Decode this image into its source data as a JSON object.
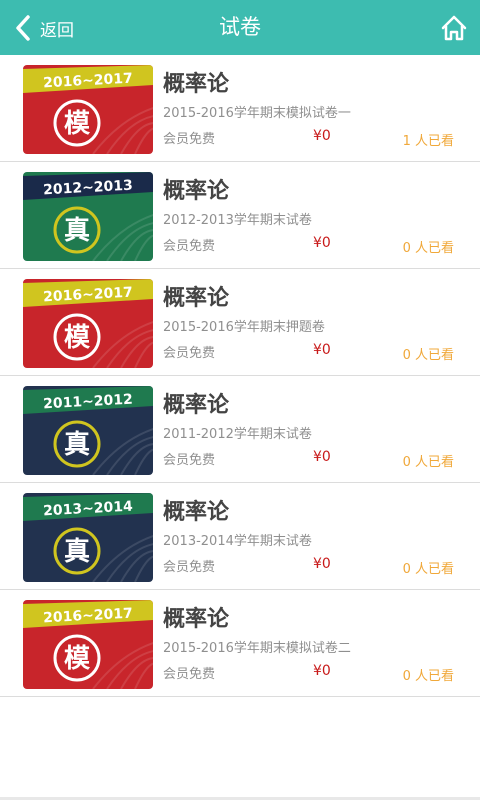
{
  "header": {
    "back_label": "返回",
    "title": "试卷",
    "bg_color": "#3dbcb0"
  },
  "items": [
    {
      "badge_year": "2016~2017",
      "badge_char": "模",
      "theme": "red",
      "name": "概率论",
      "subtitle": "2015-2016学年期末模拟试卷一",
      "member": "会员免费",
      "price": "¥0",
      "views": "1 人已看"
    },
    {
      "badge_year": "2012~2013",
      "badge_char": "真",
      "theme": "green",
      "name": "概率论",
      "subtitle": "2012-2013学年期末试卷",
      "member": "会员免费",
      "price": "¥0",
      "views": "0 人已看"
    },
    {
      "badge_year": "2016~2017",
      "badge_char": "模",
      "theme": "red",
      "name": "概率论",
      "subtitle": "2015-2016学年期末押题卷",
      "member": "会员免费",
      "price": "¥0",
      "views": "0 人已看"
    },
    {
      "badge_year": "2011~2012",
      "badge_char": "真",
      "theme": "navy",
      "name": "概率论",
      "subtitle": "2011-2012学年期末试卷",
      "member": "会员免费",
      "price": "¥0",
      "views": "0 人已看"
    },
    {
      "badge_year": "2013~2014",
      "badge_char": "真",
      "theme": "navy",
      "name": "概率论",
      "subtitle": "2013-2014学年期末试卷",
      "member": "会员免费",
      "price": "¥0",
      "views": "0 人已看"
    },
    {
      "badge_year": "2016~2017",
      "badge_char": "模",
      "theme": "red",
      "name": "概率论",
      "subtitle": "2015-2016学年期末模拟试卷二",
      "member": "会员免费",
      "price": "¥0",
      "views": "0 人已看"
    }
  ],
  "icons": {
    "back": "chevron-left-icon",
    "home": "home-icon"
  }
}
